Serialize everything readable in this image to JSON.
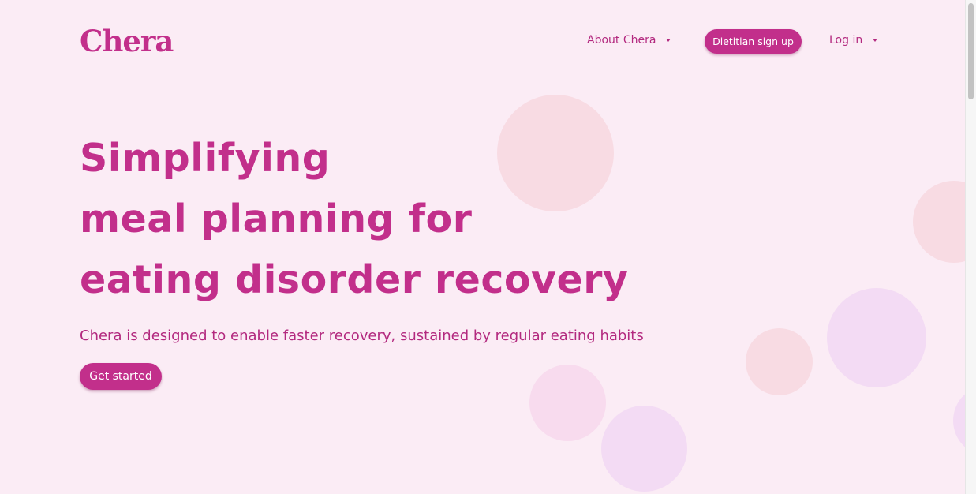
{
  "header": {
    "logo": "Chera",
    "nav": {
      "about_label": "About Chera",
      "signup_label": "Dietitian sign up",
      "login_label": "Log in"
    }
  },
  "hero": {
    "headline_lines": [
      "Simplifying",
      "meal planning for",
      "eating disorder recovery"
    ],
    "subtitle": "Chera is designed to enable faster recovery, sustained by regular eating habits",
    "cta_label": "Get started"
  },
  "colors": {
    "brand": "#c22f8b",
    "background": "#fbecf5",
    "circle_pink": "#f8dbe3",
    "circle_lavender": "#f3dbf4"
  }
}
